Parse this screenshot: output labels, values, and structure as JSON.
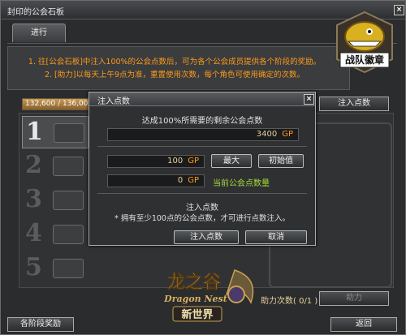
{
  "window": {
    "title": "封印的公会石板"
  },
  "tabs": [
    {
      "label": "进行"
    }
  ],
  "info": {
    "line1": "1. 往[公会石板]中注入100%的公会点数后，可为各个公会成员提供各个阶段的奖励。",
    "line2": "2. [助力]以每天上午9点为准，重置使用次数，每个角色可使用确定的次数。"
  },
  "progress": {
    "text": "132,600 / 136,000"
  },
  "inject_button_label": "注入点数",
  "stages": [
    "1",
    "2",
    "3",
    "4",
    "5"
  ],
  "dialog": {
    "title": "注入点数",
    "required_label": "达成100%所需要的剩余公会点数",
    "required_value": "3400",
    "unit": "GP",
    "input_value": "100",
    "max_label": "最大",
    "reset_label": "初始值",
    "current_value": "0",
    "current_label": "当前公会点数量",
    "section_title": "注入点数",
    "note": "* 拥有至少100点的公会点数，才可进行点数注入。",
    "confirm_label": "注入点数",
    "cancel_label": "取消"
  },
  "footer": {
    "stage_reward_label": "各阶段奖励",
    "assist_count_label": "助力次数( 0/1 )",
    "assist_button_label": "助力",
    "back_label": "返回"
  },
  "brand": {
    "line1": "龙之谷",
    "line2": "Dragon Nest",
    "line3": "新世界"
  },
  "logo_text": "战队徽章"
}
